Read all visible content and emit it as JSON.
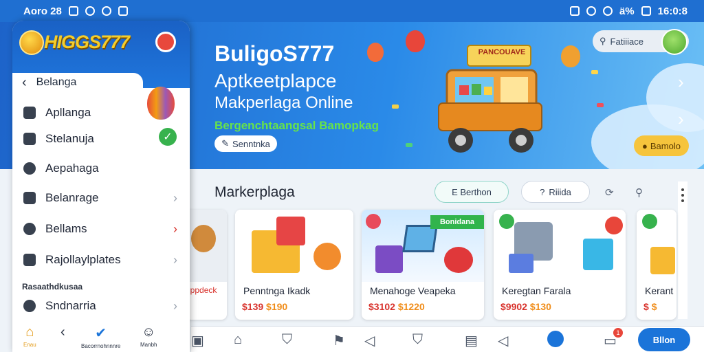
{
  "status_bar": {
    "left_text": "Aoro 28",
    "battery": "ä%",
    "time": "16:0:8"
  },
  "drawer": {
    "logo_text": "HIGGS777",
    "back_label": "Belanga",
    "items": [
      {
        "label": "Apllanga",
        "icon": "tag-icon"
      },
      {
        "label": "Stelanuja",
        "icon": "wallet-icon"
      },
      {
        "label": "Aepahaga",
        "icon": "shield-icon"
      },
      {
        "label": "Belanrage",
        "icon": "grid-icon"
      },
      {
        "label": "Bellams",
        "icon": "chat-icon"
      },
      {
        "label": "Rajollaylplates",
        "icon": "store-icon"
      },
      {
        "label": "Sndnarria",
        "icon": "gear-icon"
      }
    ],
    "section_label": "Rasaathdkusaa",
    "footer": [
      {
        "label": "Enau",
        "icon": "home-icon"
      },
      {
        "label": "",
        "icon": "back-icon"
      },
      {
        "label": "Bacorrnohnnnre",
        "icon": "check-badge-icon"
      },
      {
        "label": "Manbh",
        "icon": "user-icon"
      }
    ]
  },
  "banner": {
    "title": "BuligoS777",
    "subtitle1": "Aptkeetplapce",
    "subtitle2": "Makperlaga Online",
    "tagline": "Bergenchtaangsal Bamopkag",
    "button_label": "Senntnka",
    "truck_sign": "PANCOUAVE",
    "search_placeholder": "Fatiiiace",
    "gold_button": "Bamolo"
  },
  "section": {
    "title": "Markerplaga",
    "chip_active": "E Berthon",
    "chip2": "Riiida"
  },
  "products": [
    {
      "name": "",
      "price": "",
      "price2": "",
      "extra": "lppdeck"
    },
    {
      "name": "Penntnga Ikadk",
      "price": "$139",
      "price2": "$190"
    },
    {
      "name": "Menahoge Veapeka",
      "price": "$3102",
      "price2": "$1220",
      "ribbon": "Bonidana"
    },
    {
      "name": "Keregtan Farala",
      "price": "$9902",
      "price2": "$130"
    },
    {
      "name": "Kerant",
      "price": "$",
      "price2": "$"
    }
  ],
  "bottom_nav": {
    "cta": "Bllon",
    "badge": "1"
  },
  "colors": {
    "primary": "#1f6fd1",
    "accent_green": "#37b24d",
    "price_red": "#d8312b",
    "gold": "#f6c43c"
  }
}
